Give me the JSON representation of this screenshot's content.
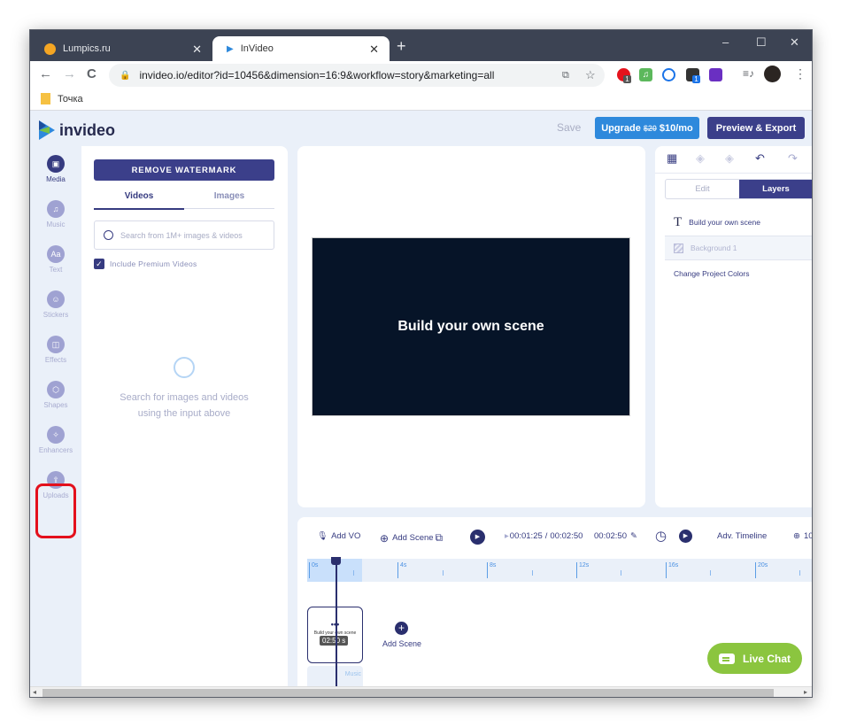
{
  "browser": {
    "tabs": [
      {
        "title": "Lumpics.ru",
        "favicon": "orange-circle",
        "active": false
      },
      {
        "title": "InVideo",
        "favicon": "invideo-logo",
        "active": true
      }
    ],
    "new_tab": "+",
    "window_controls": {
      "minimize": "–",
      "maximize": "☐",
      "close": "✕"
    },
    "url": "invideo.io/editor?id=10456&dimension=16:9&workflow=story&marketing=all",
    "nav": {
      "back": "←",
      "forward": "→",
      "reload": "C"
    },
    "extension_badges": [
      "1",
      "1"
    ],
    "bookmarks": [
      {
        "label": "Точка"
      }
    ],
    "menu": "⋮"
  },
  "app": {
    "brand": "invideo",
    "header": {
      "save_label": "Save",
      "upgrade": {
        "prefix": "Upgrade",
        "old_price": "$20",
        "price": "$10/mo"
      },
      "export_label": "Preview & Export"
    },
    "rail": {
      "items": [
        {
          "label": "Media",
          "icon": "image-icon",
          "glyph": "▣",
          "active": true
        },
        {
          "label": "Music",
          "icon": "music-icon",
          "glyph": "♫",
          "active": false
        },
        {
          "label": "Text",
          "icon": "text-icon",
          "glyph": "Aa",
          "active": false
        },
        {
          "label": "Stickers",
          "icon": "sticker-icon",
          "glyph": "☺",
          "active": false
        },
        {
          "label": "Effects",
          "icon": "effects-icon",
          "glyph": "◫",
          "active": false
        },
        {
          "label": "Shapes",
          "icon": "hexagon-icon",
          "glyph": "⬡",
          "active": false
        },
        {
          "label": "Enhancers",
          "icon": "magic-wand-icon",
          "glyph": "✧",
          "active": false
        },
        {
          "label": "Uploads",
          "icon": "upload-icon",
          "glyph": "⇪",
          "active": false
        }
      ]
    },
    "media_panel": {
      "remove_watermark": "REMOVE WATERMARK",
      "tabs": [
        {
          "label": "Videos",
          "selected": true
        },
        {
          "label": "Images",
          "selected": false
        }
      ],
      "search_placeholder": "Search from 1M+ images & videos",
      "include_premium": {
        "label": "Include Premium Videos",
        "checked": true
      },
      "empty_line1": "Search for images and videos",
      "empty_line2": "using the input above"
    },
    "canvas": {
      "scene_text": "Build your own scene",
      "scene_bg": "#061428"
    },
    "right_panel": {
      "tools": [
        "grid-icon",
        "layer-down-icon",
        "layer-up-icon",
        "undo-icon",
        "redo-icon"
      ],
      "segments": [
        {
          "label": "Edit",
          "selected": false
        },
        {
          "label": "Layers",
          "selected": true
        }
      ],
      "layers": [
        {
          "label": "Build your own scene",
          "icon": "T"
        },
        {
          "label": "Background 1",
          "icon": "background"
        }
      ],
      "change_colors": "Change Project Colors"
    },
    "timeline": {
      "add_vo": "Add VO",
      "add_scene": "Add Scene",
      "current_time": "00:01:25",
      "total_time": "00:02:50",
      "duration": "00:02:50",
      "adv_timeline": "Adv. Timeline",
      "zoom": "10",
      "ruler_ticks": [
        "0s",
        "4s",
        "8s",
        "12s",
        "16s",
        "20s"
      ],
      "scene_card": {
        "title": "Build your own scene",
        "duration": "02:50 s"
      },
      "music_label": "Music",
      "add_scene_label": "Add Scene"
    },
    "live_chat": "Live Chat"
  },
  "colors": {
    "brand_dark": "#3b3f8a",
    "upgrade_blue": "#2e89dc",
    "live_chat_green": "#8bc53f",
    "highlight_red": "#e3101c",
    "app_bg": "#eaf0f9"
  }
}
